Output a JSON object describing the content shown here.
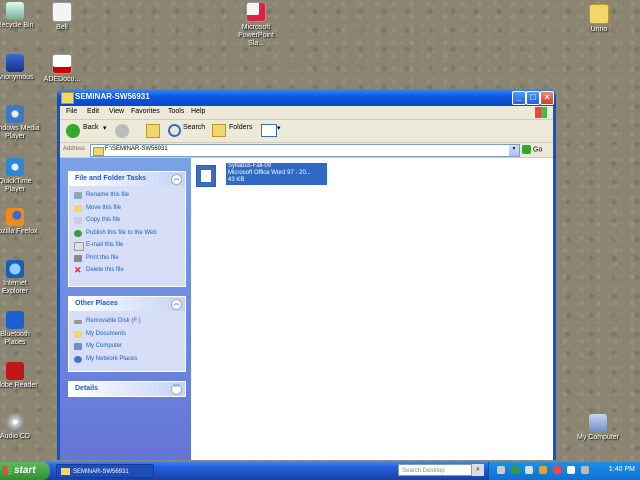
{
  "desktop": {
    "icons_left": [
      {
        "label": "Recycle Bin",
        "icon": "recycle-bin-icon"
      },
      {
        "label": "Bell",
        "icon": "document-icon"
      },
      {
        "label": "Anonymous",
        "icon": "network-icon"
      },
      {
        "label": "Windows Media Player",
        "icon": "media-player-icon"
      },
      {
        "label": "QuickTime Player",
        "icon": "quicktime-icon"
      },
      {
        "label": "Mozilla Firefox",
        "icon": "firefox-icon"
      },
      {
        "label": "Internet Explorer",
        "icon": "internet-explorer-icon"
      },
      {
        "label": "Bluetooth Places",
        "icon": "bluetooth-icon"
      },
      {
        "label": "Adobe Reader",
        "icon": "adobe-reader-icon"
      },
      {
        "label": "Audio CD",
        "icon": "cd-icon"
      }
    ],
    "icons_top": [
      {
        "label": "Microsoft PowerPoint Sla...",
        "icon": "powerpoint-icon"
      },
      {
        "label": "Unno",
        "icon": "folder-icon"
      },
      {
        "label": "ADEDocu...",
        "icon": "pdf-icon"
      }
    ],
    "my_computer_label": "My Computer"
  },
  "window": {
    "title": "SEMINAR-SW56931",
    "menu": [
      "File",
      "Edit",
      "View",
      "Favorites",
      "Tools",
      "Help"
    ],
    "toolbar": {
      "back": "Back",
      "search": "Search",
      "folders": "Folders"
    },
    "address": {
      "label": "Address",
      "value": "F:\\SEMINAR-SW56931",
      "go": "Go"
    },
    "file_tasks": {
      "title": "File and Folder Tasks",
      "items": [
        "Rename this file",
        "Move this file",
        "Copy this file",
        "Publish this file to the Web",
        "E-mail this file",
        "Print this file",
        "Delete this file"
      ]
    },
    "other_places": {
      "title": "Other Places",
      "items": [
        "Removable Disk (F:)",
        "My Documents",
        "My Computer",
        "My Network Places"
      ]
    },
    "details": {
      "title": "Details"
    },
    "file": {
      "name": "Syllabus-Fall-09",
      "type": "Microsoft Office Word 97 - 20...",
      "size": "43 KB"
    }
  },
  "taskbar": {
    "start": "start",
    "task": "SEMINAR-SW56931",
    "search_placeholder": "Search Desktop",
    "clock": "1:40 PM"
  }
}
